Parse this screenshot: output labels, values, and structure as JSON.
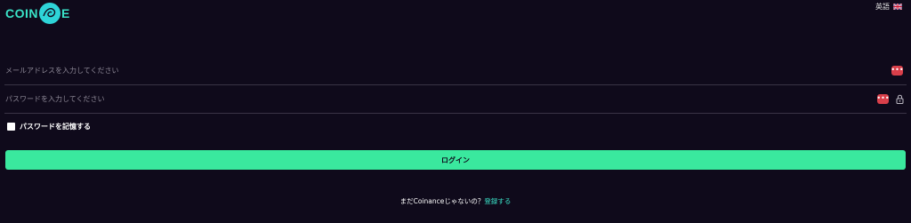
{
  "brand": {
    "logo_left": "COIN",
    "logo_right": "E",
    "accent_color": "#3ae3c8"
  },
  "language": {
    "label": "英語",
    "flag_icon": "uk-flag-icon"
  },
  "form": {
    "email_placeholder": "メールアドレスを入力してください",
    "password_placeholder": "パスワードを入力してください",
    "remember_label": "パスワードを記憶する",
    "login_label": "ログイン",
    "dots_label": "•••"
  },
  "footer": {
    "prompt": "まだCoinanceじゃないの？",
    "signup_link": "登録する"
  },
  "colors": {
    "background": "#0f0a1b",
    "button": "#3ae89e",
    "danger": "#d93f4a"
  }
}
